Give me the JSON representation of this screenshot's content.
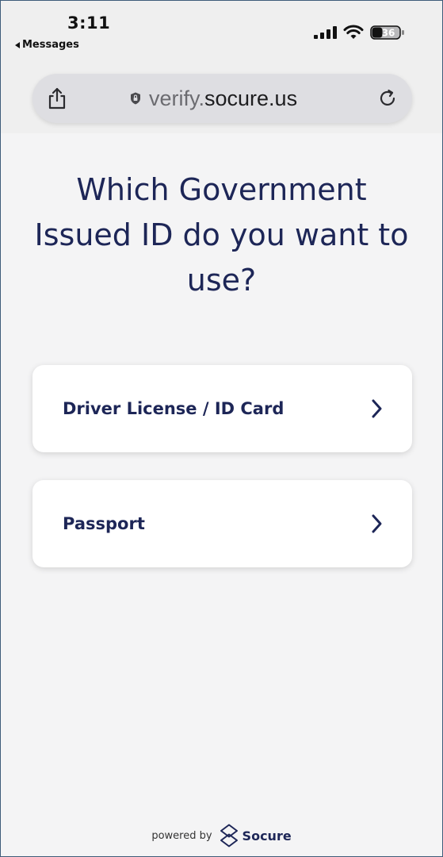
{
  "status_bar": {
    "time": "3:11",
    "back_label": "Messages",
    "battery_level": "36",
    "icons": [
      "cellular-signal-icon",
      "wifi-icon",
      "battery-icon"
    ]
  },
  "browser": {
    "url_subdomain": "verify.",
    "url_domain": "socure.us",
    "icons": [
      "share-icon",
      "shield-lock-icon",
      "reload-icon"
    ]
  },
  "page": {
    "heading_line1": "Which Government",
    "heading_line2": "Issued ID do you want to",
    "heading_line3": "use?",
    "options": [
      {
        "label": "Driver License / ID Card",
        "icon": "chevron-right-icon"
      },
      {
        "label": "Passport",
        "icon": "chevron-right-icon"
      }
    ]
  },
  "footer": {
    "powered_by": "powered by",
    "brand": "Socure",
    "brand_icon": "socure-logo-icon"
  },
  "colors": {
    "heading": "#1d2657",
    "background": "#f4f4f5",
    "card": "#ffffff",
    "frame_border": "#3e5c7a"
  }
}
